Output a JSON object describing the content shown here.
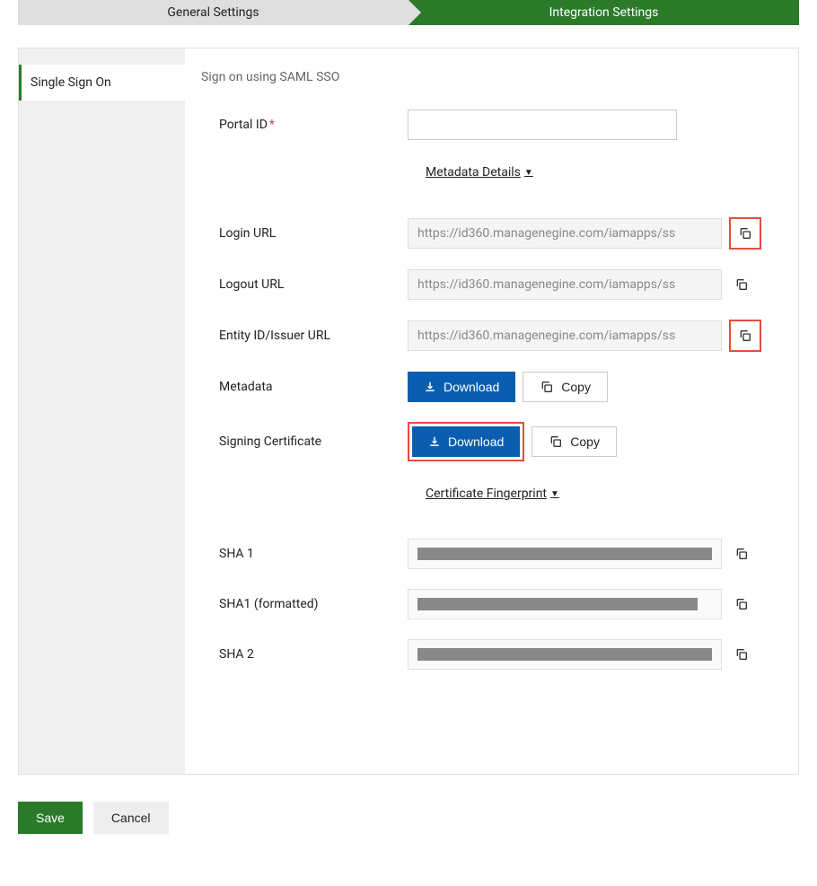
{
  "tabs": {
    "general": "General Settings",
    "integration": "Integration Settings"
  },
  "sidebar": {
    "items": [
      "Single Sign On"
    ]
  },
  "main": {
    "title": "Sign on using SAML SSO",
    "metadata_details_label": "Metadata Details",
    "certificate_fingerprint_label": "Certificate Fingerprint",
    "fields": {
      "portal_id": {
        "label": "Portal ID",
        "value": ""
      },
      "login_url": {
        "label": "Login URL",
        "value": "https://id360.managenegine.com/iamapps/ss"
      },
      "logout_url": {
        "label": "Logout URL",
        "value": "https://id360.managenegine.com/iamapps/ss"
      },
      "entity_id": {
        "label": "Entity ID/Issuer URL",
        "value": "https://id360.managenegine.com/iamapps/ss"
      },
      "metadata": {
        "label": "Metadata"
      },
      "signing_cert": {
        "label": "Signing Certificate"
      },
      "sha1": {
        "label": "SHA 1"
      },
      "sha1_formatted": {
        "label": "SHA1 (formatted)"
      },
      "sha2": {
        "label": "SHA 2"
      }
    },
    "buttons": {
      "download": "Download",
      "copy": "Copy"
    }
  },
  "footer": {
    "save": "Save",
    "cancel": "Cancel"
  }
}
